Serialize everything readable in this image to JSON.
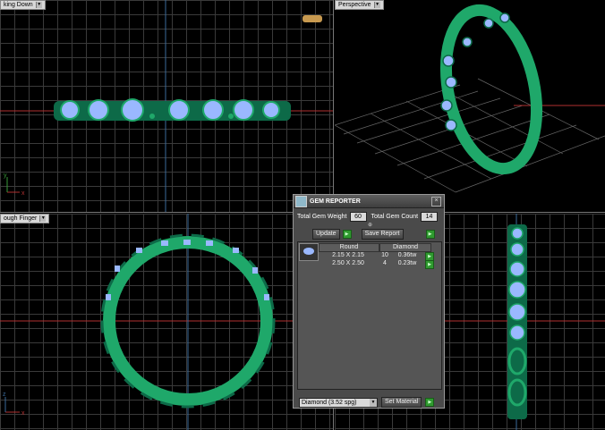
{
  "viewports": {
    "top": {
      "label": "king Down"
    },
    "perspective": {
      "label": "Perspective"
    },
    "front": {
      "label": "ough Finger"
    },
    "axis_x": "x",
    "axis_y": "y",
    "axis_z": "z"
  },
  "gem_reporter": {
    "title": "GEM REPORTER",
    "close_icon": "close-icon",
    "total_weight_label": "Total Gem Weight",
    "total_weight_value": "60",
    "total_count_label": "Total Gem Count",
    "total_count_value": "14",
    "update_label": "Update",
    "save_report_label": "Save Report",
    "table": {
      "headers": [
        "Round",
        "Diamond"
      ],
      "rows": [
        {
          "size": "2.15 X 2.15",
          "count": "10",
          "weight": "0.36tw"
        },
        {
          "size": "2.50 X 2.50",
          "count": "4",
          "weight": "0.23tw"
        }
      ]
    },
    "material_select": "Diamond    (3.52 spg)",
    "set_material_label": "Set Material"
  },
  "colors": {
    "metal": "#1fa86a",
    "gem": "#9ab8ff",
    "accent_green": "#2f9a2f"
  }
}
